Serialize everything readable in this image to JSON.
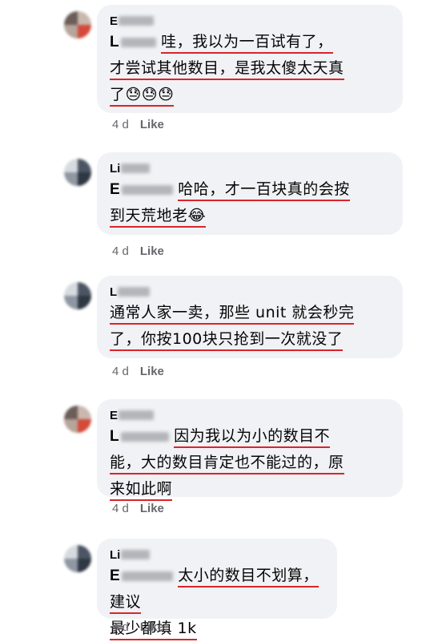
{
  "comments": [
    {
      "author_initial": "E",
      "mention_initial": "L",
      "lines": [
        "哇，我以为一百试有了，",
        "才尝试其他数目，是我太傻太天真",
        "了😓😓😓"
      ],
      "time": "4 d",
      "like_label": "Like"
    },
    {
      "author_initial": "Li",
      "mention_initial": "E",
      "lines": [
        "哈哈，才一百块真的会按",
        "到天荒地老😂"
      ],
      "time": "4 d",
      "like_label": "Like"
    },
    {
      "author_initial": "L",
      "mention_initial": "",
      "lines": [
        "通常人家一卖，那些 unit 就会秒完",
        "了，你按100块只抢到一次就没了"
      ],
      "time": "4 d",
      "like_label": "Like"
    },
    {
      "author_initial": "E",
      "mention_initial": "L",
      "lines": [
        "因为我以为小的数目不",
        "能，大的数目肯定也不能过的，原",
        "来如此啊"
      ],
      "time": "4 d",
      "like_label": "Like"
    },
    {
      "author_initial": "Li",
      "mention_initial": "E",
      "lines": [
        "太小的数目不划算，建议",
        "最少都填 1k"
      ],
      "time": "4 d",
      "like_label": "Like"
    }
  ],
  "colors": {
    "bubble": "#f0f2f5",
    "underline": "#d9252a",
    "meta_text": "#65676b"
  }
}
